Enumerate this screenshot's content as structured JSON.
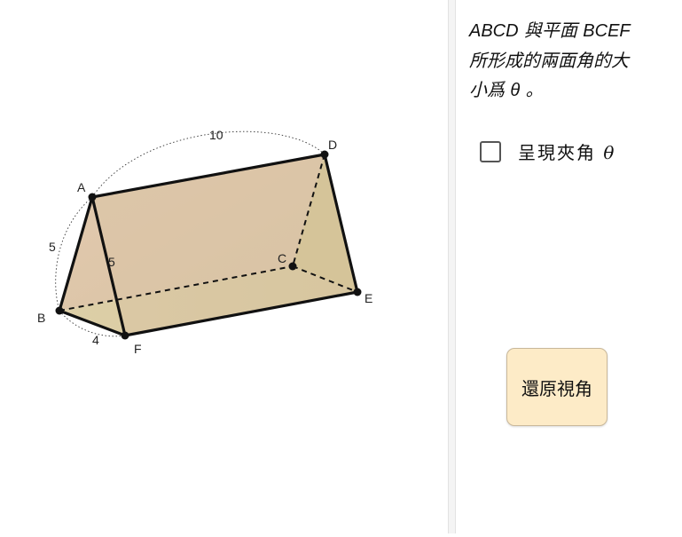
{
  "statement": {
    "plane1": "ABCD",
    "connector": " 與平面 ",
    "plane2": "BCEF",
    "line2": "所形成的兩面角的大",
    "line3_prefix": "小爲 ",
    "theta": "θ",
    "line3_suffix": " 。"
  },
  "toggle": {
    "label": "呈現夾角 ",
    "theta": "θ",
    "checked": false
  },
  "restore_button": {
    "label": "還原視角"
  },
  "diagram": {
    "points": {
      "A": "A",
      "B": "B",
      "C": "C",
      "D": "D",
      "E": "E",
      "F": "F"
    },
    "lengths": {
      "AD": "10",
      "AB": "5",
      "AF": "5",
      "BF": "4"
    },
    "colors": {
      "face_abcd": "#d9c0a6",
      "face_bcef": "#d8cc9e",
      "face_abf": "#ecebdc",
      "face_dce": "#d2c68e",
      "edge": "#111111"
    }
  }
}
